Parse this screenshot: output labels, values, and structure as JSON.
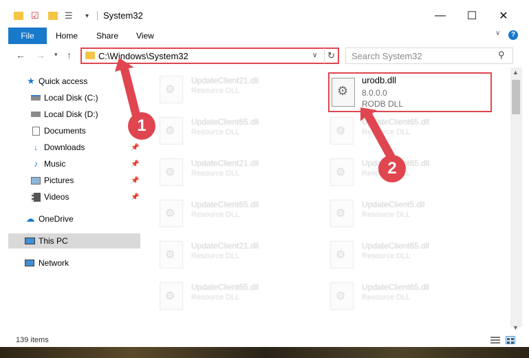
{
  "window": {
    "title": "System32"
  },
  "ribbon": {
    "tabs": [
      "File",
      "Home",
      "Share",
      "View"
    ]
  },
  "address": {
    "path": "C:\\Windows\\System32",
    "search_placeholder": "Search System32"
  },
  "sidebar": {
    "items": [
      {
        "label": "Quick access",
        "icon": "star-icon",
        "pinned": false
      },
      {
        "label": "Local Disk (C:)",
        "icon": "drive-icon",
        "pinned": false
      },
      {
        "label": "Local Disk (D:)",
        "icon": "drive-icon",
        "pinned": false
      },
      {
        "label": "Documents",
        "icon": "documents-icon",
        "pinned": false
      },
      {
        "label": "Downloads",
        "icon": "download-icon",
        "pinned": true
      },
      {
        "label": "Music",
        "icon": "music-icon",
        "pinned": true
      },
      {
        "label": "Pictures",
        "icon": "pictures-icon",
        "pinned": true
      },
      {
        "label": "Videos",
        "icon": "videos-icon",
        "pinned": true
      },
      {
        "label": "OneDrive",
        "icon": "cloud-icon",
        "pinned": false
      },
      {
        "label": "This PC",
        "icon": "pc-icon",
        "pinned": false
      },
      {
        "label": "Network",
        "icon": "network-icon",
        "pinned": false
      }
    ]
  },
  "files": {
    "highlighted": {
      "name": "urodb.dll",
      "version": "8.0.0.0",
      "type": "RODB DLL"
    },
    "left_column": [
      {
        "name": "UpdateClient21.dll",
        "type": "Resource DLL"
      },
      {
        "name": "UpdateClient65.dll",
        "type": "Resource DLL"
      },
      {
        "name": "UpdateClient21.dll",
        "type": "Resource DLL"
      },
      {
        "name": "UpdateClient65.dll",
        "type": "Resource DLL"
      },
      {
        "name": "UpdateClient21.dll",
        "type": "Resource DLL"
      },
      {
        "name": "UpdateClient65.dll",
        "type": "Resource DLL"
      }
    ],
    "right_column": [
      {
        "name": "UpdateClient65.dll",
        "type": "Resource DLL"
      },
      {
        "name": "UpdateClient65.dll",
        "type": "Resource DLL"
      },
      {
        "name": "UpdateClient5.dll",
        "type": "Resource DLL"
      },
      {
        "name": "UpdateClient65.dll",
        "type": "Resource DLL"
      },
      {
        "name": "UpdateClient65.dll",
        "type": "Resource DLL"
      }
    ]
  },
  "status": {
    "item_count": "139 items"
  },
  "callouts": {
    "one": "1",
    "two": "2"
  },
  "colors": {
    "accent": "#1979ca",
    "highlight": "#e0464f"
  }
}
